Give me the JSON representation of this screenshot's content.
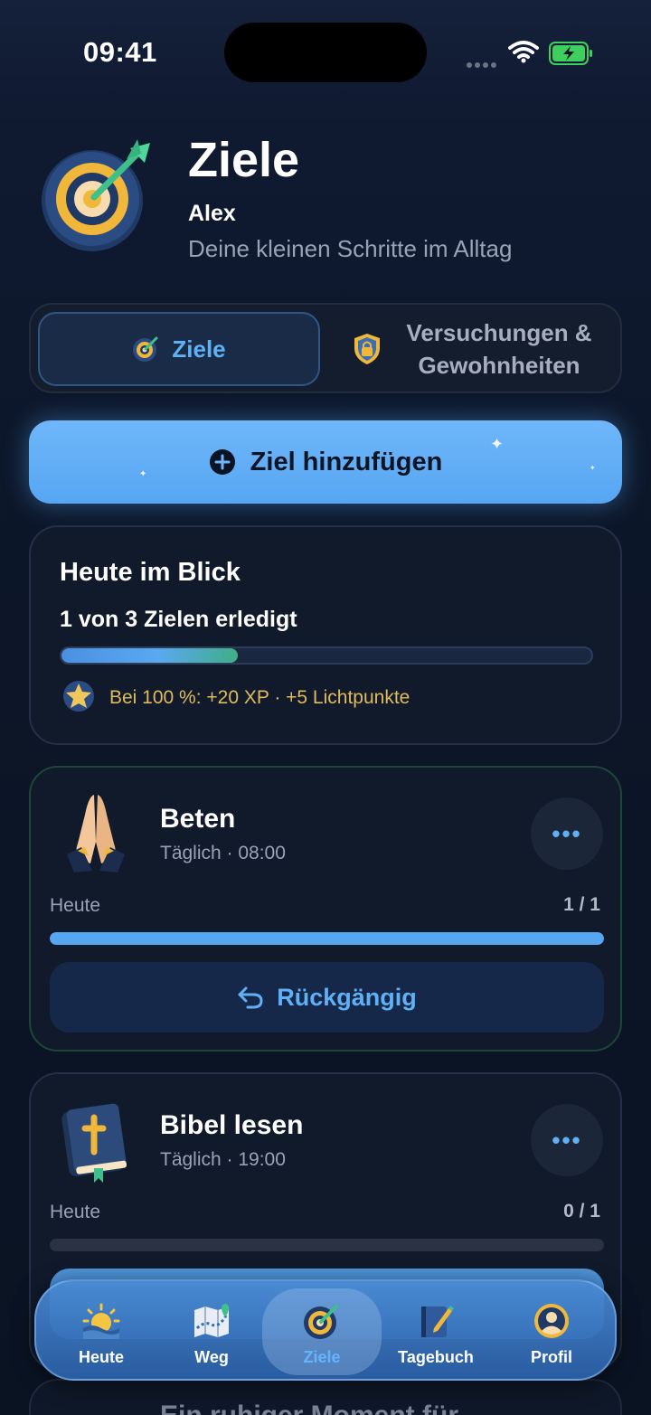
{
  "status_bar": {
    "time": "09:41"
  },
  "header": {
    "title": "Ziele",
    "user": "Alex",
    "subtitle": "Deine kleinen Schritte im Alltag"
  },
  "segments": [
    {
      "label": "Ziele",
      "active": true,
      "icon": "target-icon"
    },
    {
      "label": "Versuchungen & Gewohnheiten",
      "active": false,
      "icon": "shield-lock-icon"
    }
  ],
  "add_button": {
    "label": "Ziel hinzufügen",
    "icon": "plus-circle-icon"
  },
  "overview": {
    "title": "Heute im Blick",
    "progress_text": "1 von 3 Zielen erledigt",
    "progress_fraction": 0.333,
    "reward_text": "Bei 100 %: +20 XP · +5 Lichtpunkte",
    "reward_icon": "star-badge-icon"
  },
  "goals": [
    {
      "name": "Beten",
      "schedule": "Täglich · 08:00",
      "icon": "praying-hands-icon",
      "today_label": "Heute",
      "count": "1 / 1",
      "progress_fraction": 1.0,
      "action_label": "Rückgängig",
      "action_icon": "undo-icon"
    },
    {
      "name": "Bibel lesen",
      "schedule": "Täglich · 19:00",
      "icon": "bible-icon",
      "today_label": "Heute",
      "count": "0 / 1",
      "progress_fraction": 0.0
    }
  ],
  "peek_goal": {
    "name": "Ein ruhiger Moment für"
  },
  "tabbar": {
    "items": [
      {
        "label": "Heute",
        "icon": "sunrise-icon",
        "active": false
      },
      {
        "label": "Weg",
        "icon": "map-icon",
        "active": false
      },
      {
        "label": "Ziele",
        "icon": "target-icon",
        "active": true
      },
      {
        "label": "Tagebuch",
        "icon": "journal-icon",
        "active": false
      },
      {
        "label": "Profil",
        "icon": "profile-icon",
        "active": false
      }
    ]
  },
  "colors": {
    "accent": "#5fb0f5",
    "button": "#56a6f2",
    "reward": "#e0ba5c",
    "background": "#0d1526"
  }
}
